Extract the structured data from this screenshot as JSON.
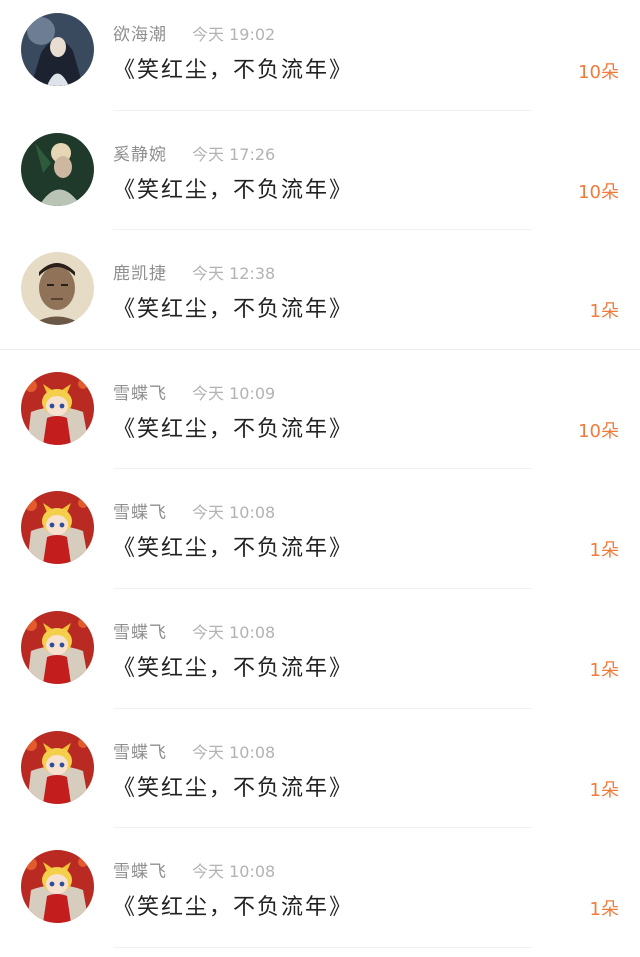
{
  "rows": [
    {
      "name": "欲海潮",
      "time": "今天 19:02",
      "title": "《笑红尘，不负流年》",
      "count": "10朵",
      "avatar": "avatar-girl-dark-hair"
    },
    {
      "name": "奚静婉",
      "time": "今天 17:26",
      "title": "《笑红尘，不负流年》",
      "count": "10朵",
      "avatar": "avatar-woman-green"
    },
    {
      "name": "鹿凯捷",
      "time": "今天 12:38",
      "title": "《笑红尘，不负流年》",
      "count": "1朵",
      "avatar": "avatar-man-portrait"
    },
    {
      "name": "雪蝶飞",
      "time": "今天 10:09",
      "title": "《笑红尘，不负流年》",
      "count": "10朵",
      "avatar": "avatar-anime-fox"
    },
    {
      "name": "雪蝶飞",
      "time": "今天 10:08",
      "title": "《笑红尘，不负流年》",
      "count": "1朵",
      "avatar": "avatar-anime-fox"
    },
    {
      "name": "雪蝶飞",
      "time": "今天 10:08",
      "title": "《笑红尘，不负流年》",
      "count": "1朵",
      "avatar": "avatar-anime-fox"
    },
    {
      "name": "雪蝶飞",
      "time": "今天 10:08",
      "title": "《笑红尘，不负流年》",
      "count": "1朵",
      "avatar": "avatar-anime-fox"
    },
    {
      "name": "雪蝶飞",
      "time": "今天 10:08",
      "title": "《笑红尘，不负流年》",
      "count": "1朵",
      "avatar": "avatar-anime-fox"
    }
  ],
  "colors": {
    "name": "#8f8f8f",
    "time": "#b3b3b3",
    "title": "#222222",
    "count": "#f07b3b"
  }
}
